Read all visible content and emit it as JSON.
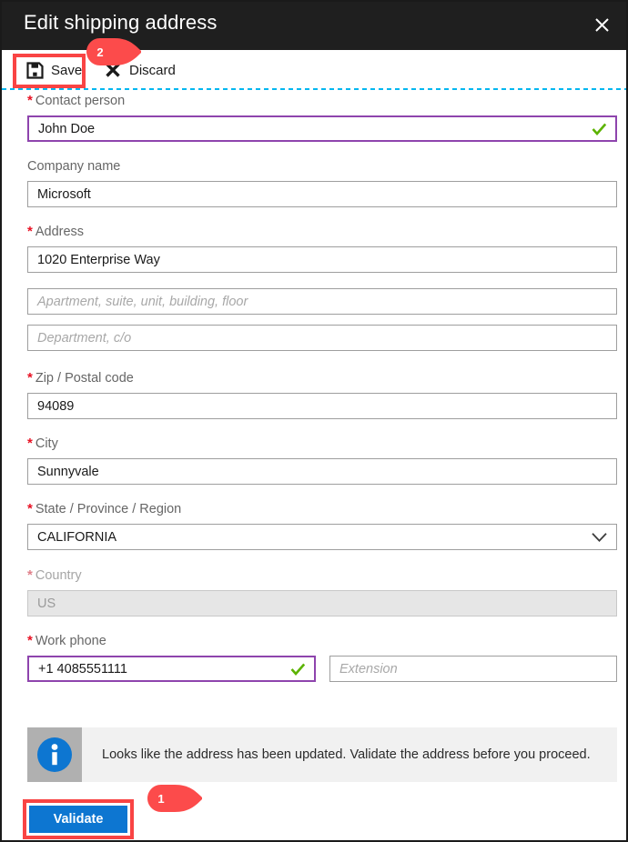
{
  "window": {
    "title": "Edit shipping address",
    "close_icon": "close-icon"
  },
  "toolbar": {
    "save_label": "Save",
    "save_icon": "save-floppy-icon",
    "discard_label": "Discard",
    "discard_icon": "x-cross-icon"
  },
  "form": {
    "fields": [
      {
        "key": "contact_person",
        "label": "Contact person",
        "required": true,
        "value": "John Doe",
        "placeholder": "",
        "state": "focused-valid"
      },
      {
        "key": "company_name",
        "label": "Company name",
        "required": false,
        "value": "Microsoft",
        "placeholder": "",
        "state": "normal"
      },
      {
        "key": "address",
        "label": "Address",
        "required": true,
        "value": "1020 Enterprise Way",
        "placeholder": "",
        "state": "normal"
      },
      {
        "key": "address_line2",
        "label": "",
        "required": false,
        "value": "",
        "placeholder": "Apartment, suite, unit, building, floor",
        "state": "normal"
      },
      {
        "key": "address_line3",
        "label": "",
        "required": false,
        "value": "",
        "placeholder": "Department, c/o",
        "state": "normal"
      },
      {
        "key": "zip_postal_code",
        "label": "Zip / Postal code",
        "required": true,
        "value": "94089",
        "placeholder": "",
        "state": "normal"
      },
      {
        "key": "city",
        "label": "City",
        "required": true,
        "value": "Sunnyvale",
        "placeholder": "",
        "state": "normal"
      },
      {
        "key": "state_province_region",
        "label": "State / Province / Region",
        "required": true,
        "value": "CALIFORNIA",
        "placeholder": "",
        "state": "select"
      },
      {
        "key": "country",
        "label": "Country",
        "required": true,
        "value": "US",
        "placeholder": "",
        "state": "disabled"
      },
      {
        "key": "work_phone",
        "label": "Work phone",
        "required": true,
        "value": "+1 4085551111",
        "placeholder": "",
        "state": "focused-valid"
      },
      {
        "key": "extension",
        "label": "",
        "required": false,
        "value": "",
        "placeholder": "Extension",
        "state": "normal"
      }
    ]
  },
  "info_bar": {
    "icon": "info-circle-icon",
    "message": "Looks like the address has been updated. Validate the address before you proceed."
  },
  "actions": {
    "validate_label": "Validate"
  },
  "callouts": [
    {
      "id": "callout-1",
      "number": "1",
      "target": "validate-button"
    },
    {
      "id": "callout-2",
      "number": "2",
      "target": "save-button"
    }
  ],
  "colors": {
    "titlebar_bg": "#1f1f1f",
    "accent_blue": "#0d76d1",
    "required_red": "#e81123",
    "highlight_red": "#f94444",
    "focus_purple": "#8e44ad",
    "valid_green": "#5cb300",
    "dashed_cyan": "#00b7f0",
    "info_icon_blue": "#0d76d1",
    "info_bar_bg": "#f1f1f1"
  }
}
